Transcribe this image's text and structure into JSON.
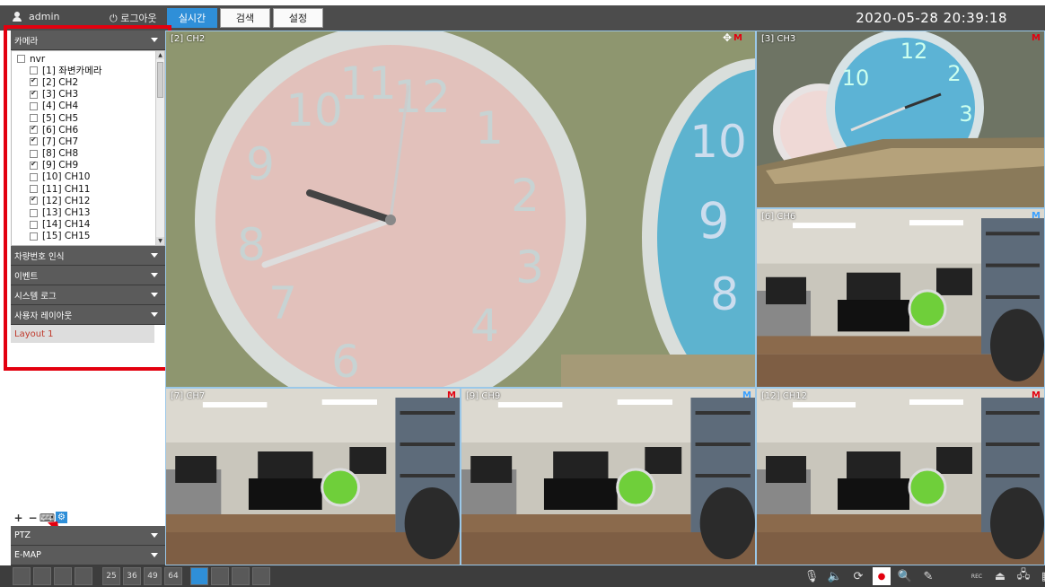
{
  "header": {
    "username": "admin",
    "logout_label": "⏻ 로그아웃",
    "tabs": [
      {
        "label": "실시간",
        "active": true
      },
      {
        "label": "검색",
        "active": false
      },
      {
        "label": "설정",
        "active": false
      }
    ],
    "datetime": "2020-05-28 20:39:18"
  },
  "sidebar": {
    "camera_section_label": "카메라",
    "tree": {
      "root": "nvr",
      "items": [
        {
          "label": "[1] 좌변카메라",
          "checked": false
        },
        {
          "label": "[2] CH2",
          "checked": true
        },
        {
          "label": "[3] CH3",
          "checked": true
        },
        {
          "label": "[4] CH4",
          "checked": false
        },
        {
          "label": "[5] CH5",
          "checked": false
        },
        {
          "label": "[6] CH6",
          "checked": true
        },
        {
          "label": "[7] CH7",
          "checked": true
        },
        {
          "label": "[8] CH8",
          "checked": false
        },
        {
          "label": "[9] CH9",
          "checked": true
        },
        {
          "label": "[10] CH10",
          "checked": false
        },
        {
          "label": "[11] CH11",
          "checked": false
        },
        {
          "label": "[12] CH12",
          "checked": true
        },
        {
          "label": "[13] CH13",
          "checked": false
        },
        {
          "label": "[14] CH14",
          "checked": false
        },
        {
          "label": "[15] CH15",
          "checked": false
        }
      ]
    },
    "sections": [
      {
        "label": "차량번호 인식"
      },
      {
        "label": "이벤트"
      },
      {
        "label": "시스템 로그"
      },
      {
        "label": "사용자 레이아웃"
      }
    ],
    "layout_item": "Layout 1",
    "tools": [
      {
        "icon": "plus-icon",
        "glyph": "+"
      },
      {
        "icon": "minus-icon",
        "glyph": "−"
      },
      {
        "icon": "keyboard-icon",
        "glyph": "⌨"
      },
      {
        "icon": "gear-icon",
        "glyph": "⚙"
      }
    ],
    "ptz_label": "PTZ",
    "emap_label": "E-MAP"
  },
  "cameras": [
    {
      "label": "[2] CH2",
      "badge": "M",
      "badge_color": "#e3000f",
      "scene": "clock-close"
    },
    {
      "label": "[3] CH3",
      "badge": "M",
      "badge_color": "#e3000f",
      "scene": "clock-wall"
    },
    {
      "label": "[6] CH6",
      "badge": "M",
      "badge_color": "#3aa0ff",
      "scene": "office"
    },
    {
      "label": "[7] CH7",
      "badge": "M",
      "badge_color": "#e3000f",
      "scene": "office"
    },
    {
      "label": "[9] CH9",
      "badge": "M",
      "badge_color": "#3aa0ff",
      "scene": "office"
    },
    {
      "label": "[12] CH12",
      "badge": "M",
      "badge_color": "#e3000f",
      "scene": "office"
    }
  ],
  "bottombar": {
    "layout_buttons": [
      "",
      "",
      "",
      "",
      "25",
      "36",
      "49",
      "64",
      "",
      "",
      "",
      ""
    ],
    "active_index": 8,
    "right_icons": [
      {
        "icon": "microphone-icon",
        "glyph": "🎙"
      },
      {
        "icon": "speaker-icon",
        "glyph": "🔈"
      },
      {
        "icon": "refresh-icon",
        "glyph": "⟳"
      },
      {
        "icon": "record-icon",
        "glyph": "●"
      },
      {
        "icon": "zoom-icon",
        "glyph": "🔍"
      },
      {
        "icon": "clear-icon",
        "glyph": "✎"
      }
    ],
    "tray_icons": [
      {
        "icon": "rec-status-icon",
        "glyph": "REC"
      },
      {
        "icon": "alarm-icon",
        "glyph": "⏏"
      },
      {
        "icon": "network-icon",
        "glyph": "🖧"
      },
      {
        "icon": "grid-icon",
        "glyph": "▦"
      }
    ]
  },
  "colors": {
    "accent": "#2f8fd8",
    "highlight": "#e3000f"
  }
}
